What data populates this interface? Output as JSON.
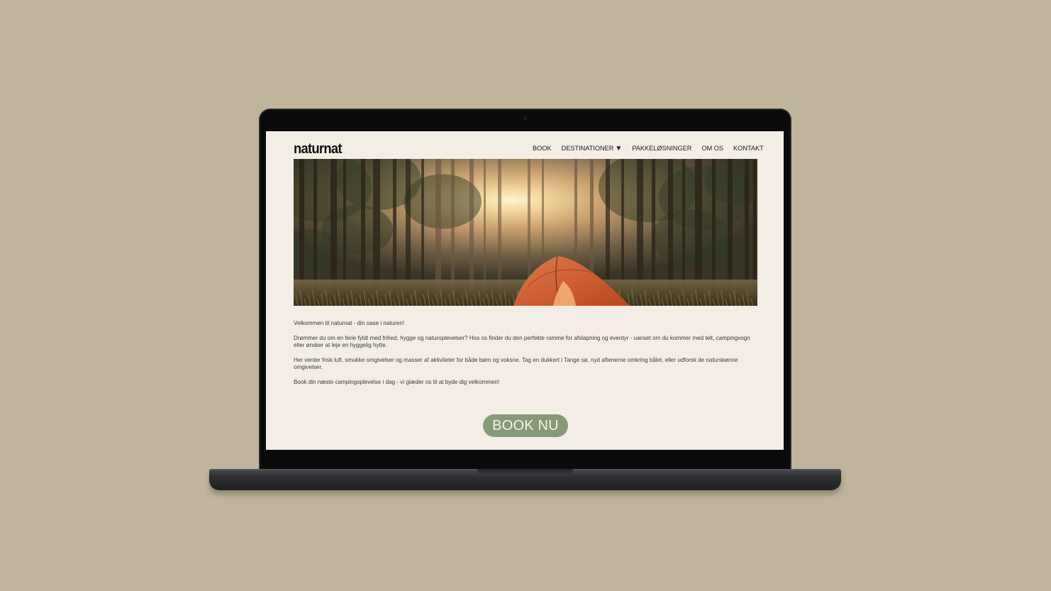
{
  "site": {
    "logo": "naturnat",
    "nav": {
      "book": "BOOK",
      "destinationer": "DESTINATIONER",
      "pakkeloesninger": "PAKKELØSNINGER",
      "om_os": "OM OS",
      "kontakt": "KONTAKT"
    },
    "hero": {
      "subject": "forest-tent-sunrise-image"
    },
    "content": {
      "welcome": "Velkommen til naturnat - din oase i naturen!",
      "p1": "Drømmer du om en ferie fyldt med frihed, hygge og naturoplevelser? Hos os finder du den perfekte ramme for afslapning og eventyr - uanset om du kommer med telt, campingvogn eller ønsker at leje en hyggelig hytte.",
      "p2": "Her venter frisk luft, smukke omgivelser og masser af aktiviteter for både børn og voksne. Tag en dukkert i Tange sø, nyd aftenerne omkring bålet, eller udforsk de naturskønne omgivelser.",
      "p3": "Book din næste campingoplevelse i dag - vi glæder os til at byde dig velkommen!"
    },
    "cta": "BOOK NU"
  },
  "colors": {
    "background": "#c0b59c",
    "screen": "#f3ede6",
    "button": "#879a78",
    "tent": "#d8602f"
  }
}
